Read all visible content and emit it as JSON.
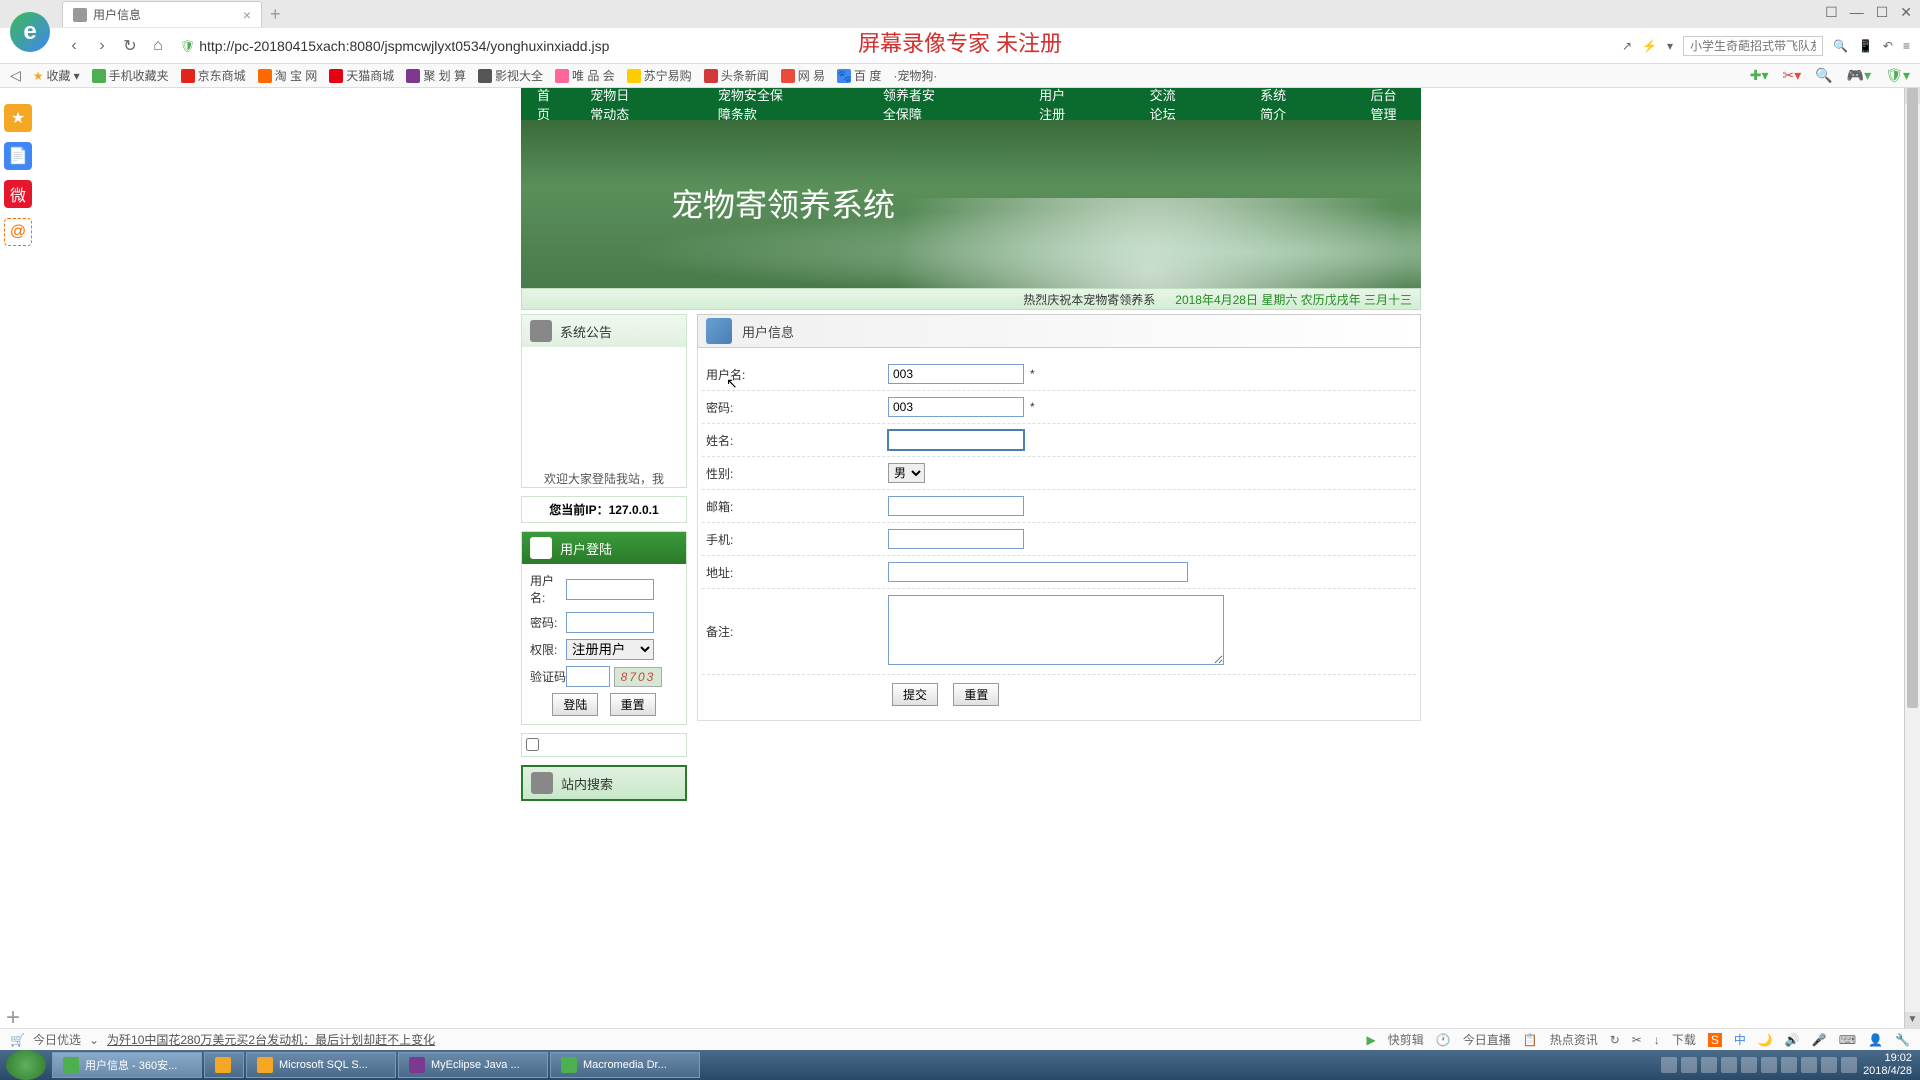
{
  "browser": {
    "tab_title": "用户信息",
    "url": "http://pc-20180415xach:8080/jspmcwjlyxt0534/yonghuxinxiadd.jsp",
    "watermark": "屏幕录像专家 未注册",
    "search_placeholder": "小学生奇葩招式带飞队友",
    "win": {
      "box": "☐",
      "min": "—",
      "max": "☐",
      "close": "✕"
    }
  },
  "bookmarks": {
    "fav": "收藏",
    "items": [
      "手机收藏夹",
      "京东商城",
      "淘 宝 网",
      "天猫商城",
      "聚 划 算",
      "影视大全",
      "唯 品 会",
      "苏宁易购",
      "头条新闻",
      "网 易",
      "百 度",
      "·宠物狗·"
    ]
  },
  "main_nav": [
    "首页",
    "宠物日常动态",
    "宠物安全保障条款",
    "领养者安全保障",
    "用户注册",
    "交流论坛",
    "系统简介",
    "后台管理"
  ],
  "banner_title": "宠物寄领养系统",
  "status": {
    "marquee": "热烈庆祝本宠物寄领养系",
    "date": "2018年4月28日  星期六  农历戊戌年  三月十三"
  },
  "left_col": {
    "announce_title": "系统公告",
    "announce_text": "欢迎大家登陆我站，我",
    "ip_label": "您当前IP：127.0.0.1",
    "login_title": "用户登陆",
    "login": {
      "user_label": "用户名:",
      "pass_label": "密码:",
      "role_label": "权限:",
      "role_value": "注册用户",
      "captcha_label": "验证码",
      "captcha_value": "8703",
      "submit": "登陆",
      "reset": "重置"
    },
    "search_title": "站内搜索"
  },
  "form": {
    "panel_title": "用户信息",
    "fields": {
      "username": {
        "label": "用户名:",
        "value": "003"
      },
      "password": {
        "label": "密码:",
        "value": "003"
      },
      "name": {
        "label": "姓名:",
        "value": ""
      },
      "gender": {
        "label": "性别:",
        "value": "男"
      },
      "email": {
        "label": "邮箱:",
        "value": ""
      },
      "phone": {
        "label": "手机:",
        "value": ""
      },
      "address": {
        "label": "地址:",
        "value": ""
      },
      "remark": {
        "label": "备注:",
        "value": ""
      }
    },
    "submit": "提交",
    "reset": "重置",
    "required": "*"
  },
  "bottom": {
    "today": "今日优选",
    "news": "为歼10中国花280万美元买2台发动机：最后计划却赶不上变化",
    "quick": "快剪辑",
    "live": "今日直播",
    "hot": "热点资讯",
    "download": "下载"
  },
  "taskbar": {
    "items": [
      {
        "label": "用户信息 - 360安..."
      },
      {
        "label": ""
      },
      {
        "label": "Microsoft SQL S..."
      },
      {
        "label": "MyEclipse Java ..."
      },
      {
        "label": "Macromedia Dr..."
      }
    ],
    "time": "19:02",
    "date": "2018/4/28"
  }
}
